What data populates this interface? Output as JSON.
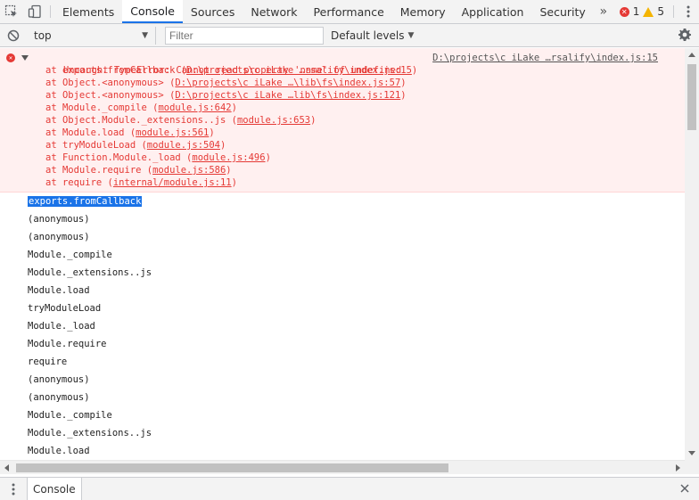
{
  "tabs": [
    {
      "label": "Elements"
    },
    {
      "label": "Console",
      "active": true
    },
    {
      "label": "Sources"
    },
    {
      "label": "Network"
    },
    {
      "label": "Performance"
    },
    {
      "label": "Memory"
    },
    {
      "label": "Application"
    },
    {
      "label": "Security"
    }
  ],
  "more_tabs": "»",
  "counts": {
    "errors": "1",
    "warnings": "5"
  },
  "filterbar": {
    "context": "top",
    "filter_placeholder": "Filter",
    "levels": "Default levels"
  },
  "error": {
    "message": "Uncaught TypeError: Cannot read property 'name' of undefined",
    "source": "D:\\projects\\c iLake …rsalify\\index.js:15",
    "frames": [
      {
        "fn": "at exports.fromCallback (",
        "loc": "D:\\projects\\c iLake …rsalify\\index.js:15",
        "end": ")"
      },
      {
        "fn": "at Object.<anonymous> (",
        "loc": "D:\\projects\\c iLake …\\lib\\fs\\index.js:57",
        "end": ")"
      },
      {
        "fn": "at Object.<anonymous> (",
        "loc": "D:\\projects\\c iLake …lib\\fs\\index.js:121",
        "end": ")"
      },
      {
        "fn": "at Module._compile (",
        "loc": "module.js:642",
        "end": ")"
      },
      {
        "fn": "at Object.Module._extensions..js (",
        "loc": "module.js:653",
        "end": ")"
      },
      {
        "fn": "at Module.load (",
        "loc": "module.js:561",
        "end": ")"
      },
      {
        "fn": "at tryModuleLoad (",
        "loc": "module.js:504",
        "end": ")"
      },
      {
        "fn": "at Function.Module._load (",
        "loc": "module.js:496",
        "end": ")"
      },
      {
        "fn": "at Module.require (",
        "loc": "module.js:586",
        "end": ")"
      },
      {
        "fn": "at require (",
        "loc": "internal/module.js:11",
        "end": ")"
      }
    ]
  },
  "lines": [
    "exports.fromCallback",
    "(anonymous)",
    "(anonymous)",
    "Module._compile",
    "Module._extensions..js",
    "Module.load",
    "tryModuleLoad",
    "Module._load",
    "Module.require",
    "require",
    "(anonymous)",
    "(anonymous)",
    "Module._compile",
    "Module._extensions..js",
    "Module.load"
  ],
  "drawer": {
    "tab": "Console"
  }
}
